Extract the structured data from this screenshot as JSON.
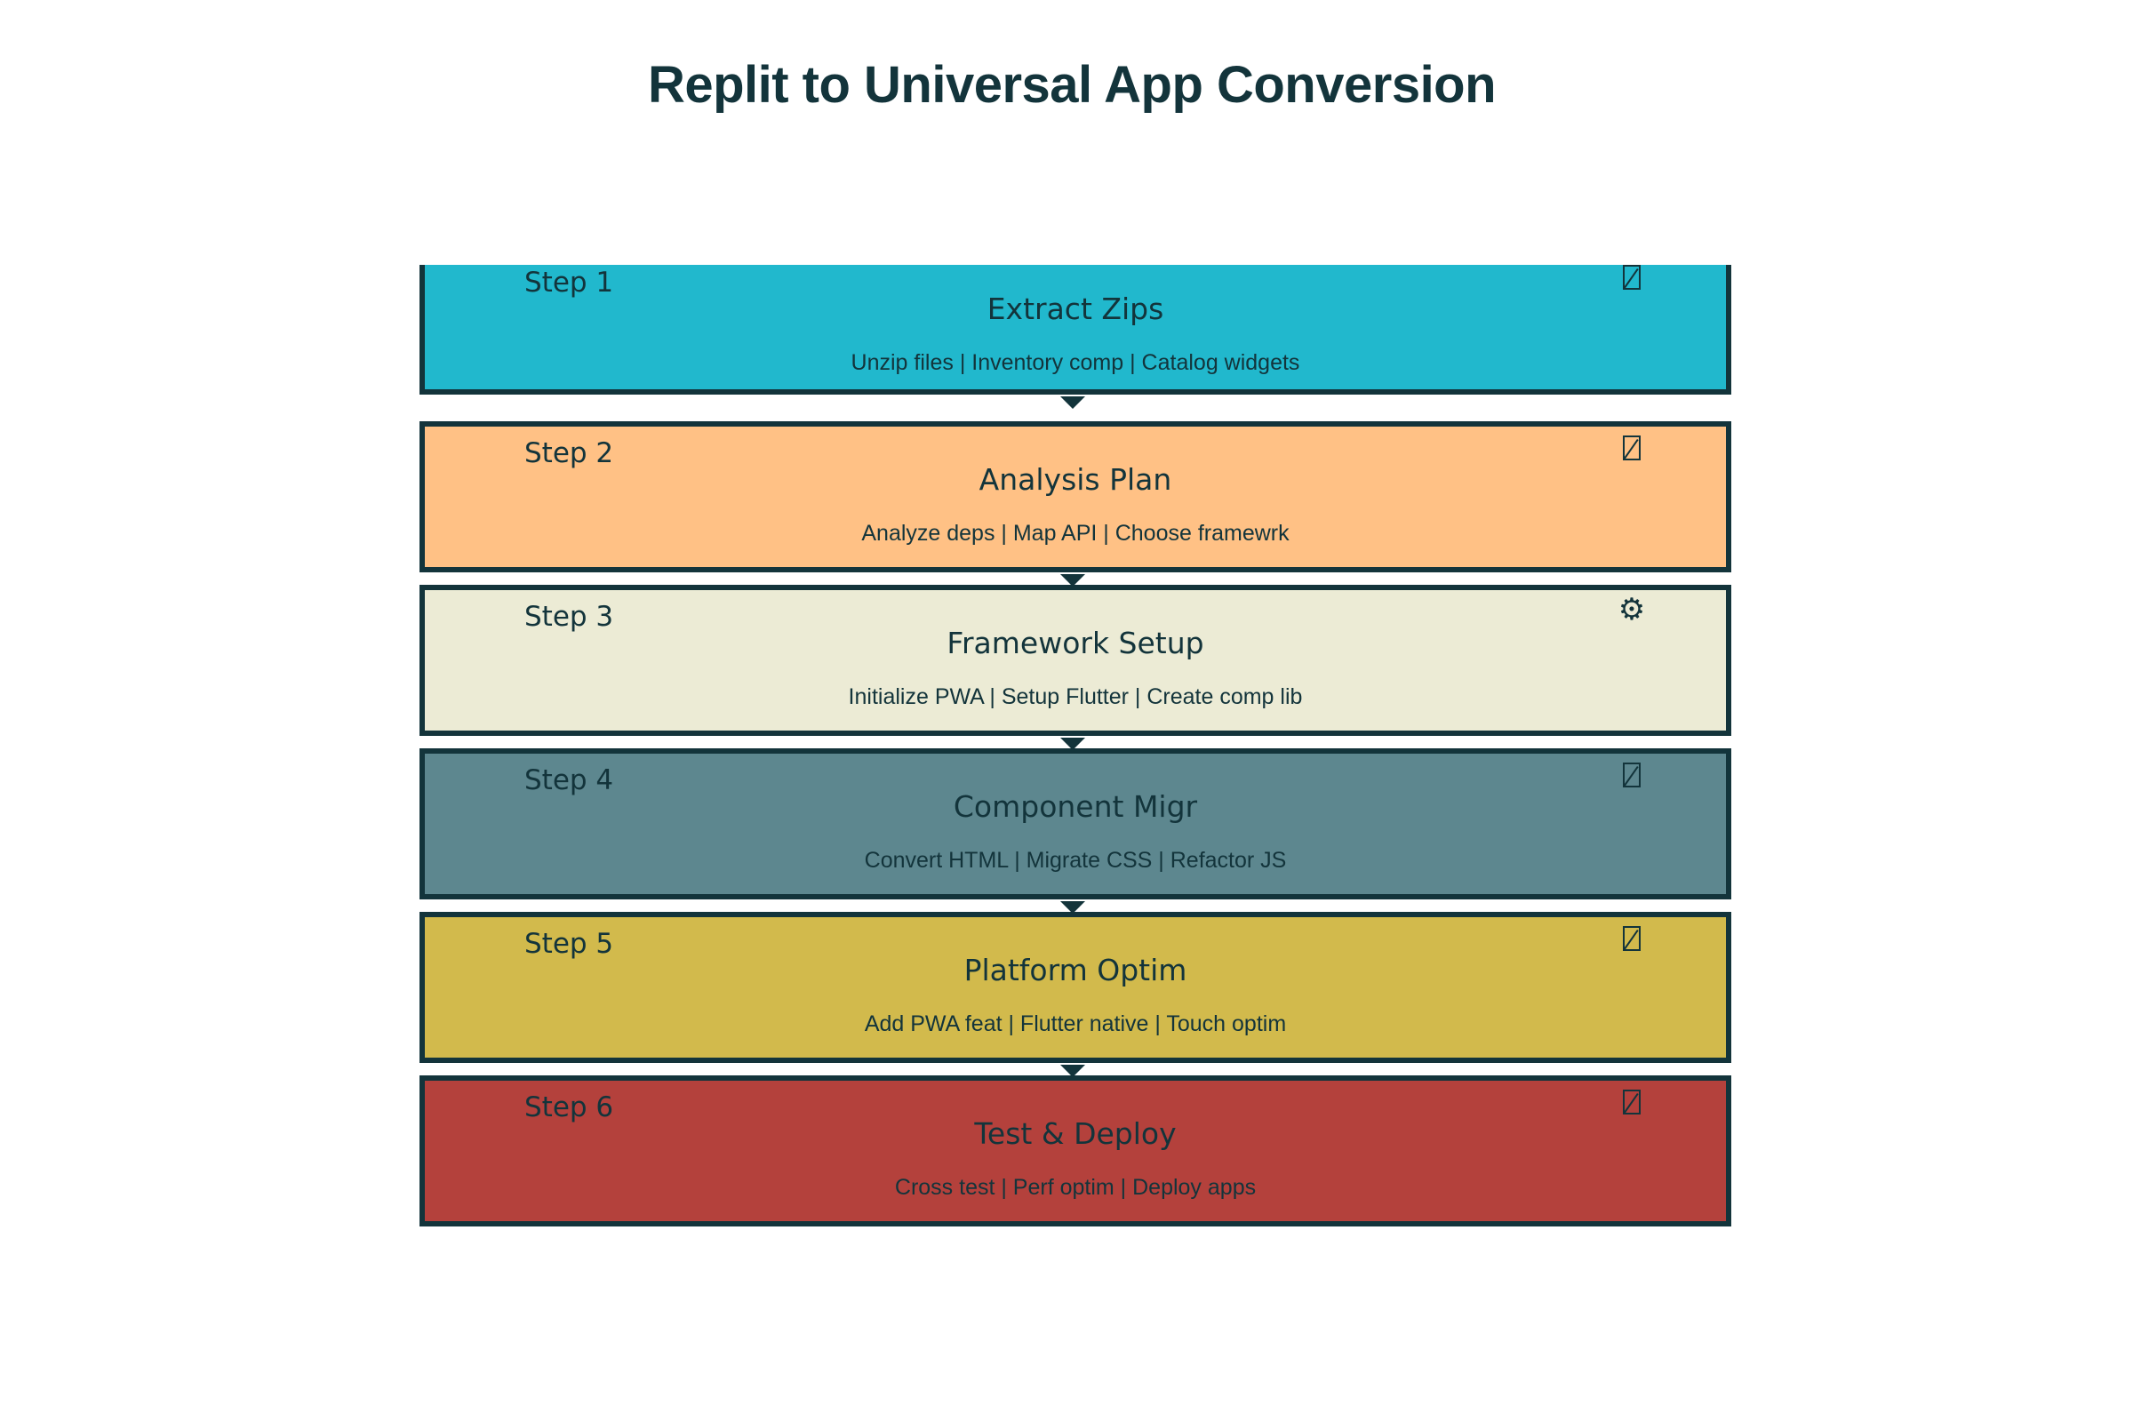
{
  "title": "Replit to Universal App Conversion",
  "steps": [
    {
      "label": "Step 1",
      "title": "Extract Zips",
      "description": "Unzip files | Inventory comp | Catalog widgets",
      "icon": "missing-glyph-icon",
      "icon_glyph": "",
      "color": "#21b8cd"
    },
    {
      "label": "Step 2",
      "title": "Analysis Plan",
      "description": "Analyze deps | Map API | Choose framewrk",
      "icon": "missing-glyph-icon",
      "icon_glyph": "",
      "color": "#ffc185"
    },
    {
      "label": "Step 3",
      "title": "Framework Setup",
      "description": "Initialize PWA | Setup Flutter | Create comp lib",
      "icon": "gear-icon",
      "icon_glyph": "⚙",
      "color": "#ecebd5"
    },
    {
      "label": "Step 4",
      "title": "Component Migr",
      "description": "Convert HTML | Migrate CSS | Refactor JS",
      "icon": "missing-glyph-icon",
      "icon_glyph": "",
      "color": "#5d878f"
    },
    {
      "label": "Step 5",
      "title": "Platform Optim",
      "description": "Add PWA feat | Flutter native | Touch optim",
      "icon": "missing-glyph-icon",
      "icon_glyph": "",
      "color": "#d2ba4c"
    },
    {
      "label": "Step 6",
      "title": "Test & Deploy",
      "description": "Cross test | Perf optim | Deploy apps",
      "icon": "missing-glyph-icon",
      "icon_glyph": "",
      "color": "#b4413c"
    }
  ],
  "colors": {
    "border": "#13343b",
    "text": "#13343b"
  }
}
